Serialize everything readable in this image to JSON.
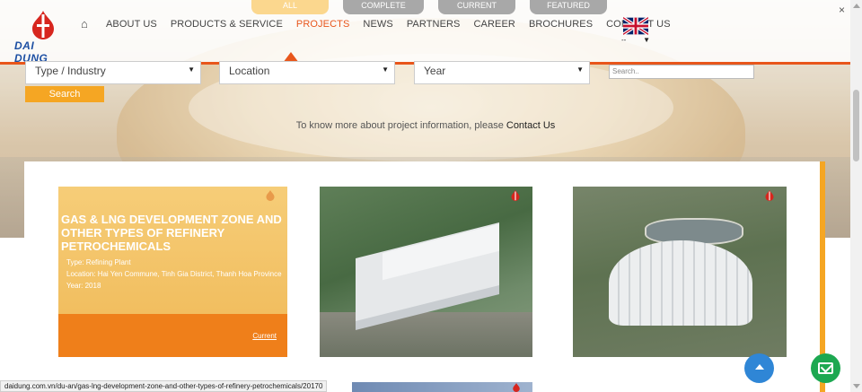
{
  "filter_tabs": [
    "ALL",
    "COMPLETE",
    "CURRENT",
    "FEATURED"
  ],
  "logo": {
    "text": "DAI DUNG"
  },
  "nav": {
    "home_icon": "home-icon",
    "items": [
      "ABOUT US",
      "PRODUCTS & SERVICE",
      "PROJECTS",
      "NEWS",
      "PARTNERS",
      "CAREER",
      "BROCHURES",
      "CONTACT US"
    ],
    "active": "PROJECTS"
  },
  "language": {
    "flag_icon": "uk-flag-icon",
    "value": "--"
  },
  "filters": {
    "type": "Type / Industry",
    "location": "Location",
    "year": "Year",
    "search_placeholder": "Search..",
    "search_button": "Search"
  },
  "info": {
    "text": "To know more about project information, please ",
    "link": "Contact Us"
  },
  "projects": [
    {
      "title": "GAS & LNG DEVELOPMENT ZONE AND OTHER TYPES OF REFINERY PETROCHEMICALS",
      "type": "Type: Refining Plant",
      "location": "Location: Hai Yen Commune, Tinh Gia District, Thanh Hoa Province",
      "year": "Year: 2018",
      "status": "Current"
    }
  ],
  "status_bar": "daidung.com.vn/du-an/gas-lng-development-zone-and-other-types-of-refinery-petrochemicals/20170",
  "colors": {
    "accent": "#e8561b",
    "orange": "#f5a623",
    "blue": "#2f86d6",
    "green": "#1da851"
  }
}
